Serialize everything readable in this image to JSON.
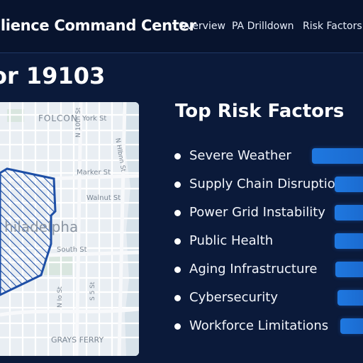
{
  "header": {
    "app_title": "ilience Command Center",
    "nav": [
      "Overview",
      "PA Drilldown",
      "Risk Factors"
    ]
  },
  "page": {
    "title": "or 19103"
  },
  "map": {
    "labels": {
      "folcon": "FOLCON",
      "york_st": "York St",
      "marker_st": "Marker St",
      "walnut_st": "Walnut St",
      "south_st": "South St",
      "city": "hiladelpha",
      "grays_ferry": "GRAYS FERRY",
      "left_st": "Nilnsam St",
      "right_st": "N Hlbnn St",
      "mid_st": "N 10th St",
      "low_st_a": "N Io St",
      "low_st_b": "S 5 St"
    },
    "highlight_color": "#1e4fa6"
  },
  "risk_factors": {
    "title": "Top Risk Factors",
    "items": [
      {
        "label": "Severe Weather",
        "bar_level": 1.0
      },
      {
        "label": "Supply Chain Disruption",
        "bar_level": 0.56
      },
      {
        "label": "Power Grid Instability",
        "bar_level": 0.56
      },
      {
        "label": "Public Health",
        "bar_level": 0.56
      },
      {
        "label": "Aging Infrastructure",
        "bar_level": 0.54
      },
      {
        "label": "Cybersecurity",
        "bar_level": 0.5
      },
      {
        "label": "Workforce Limitations",
        "bar_level": 0.44
      }
    ],
    "bar_color": "#1f78e0"
  }
}
